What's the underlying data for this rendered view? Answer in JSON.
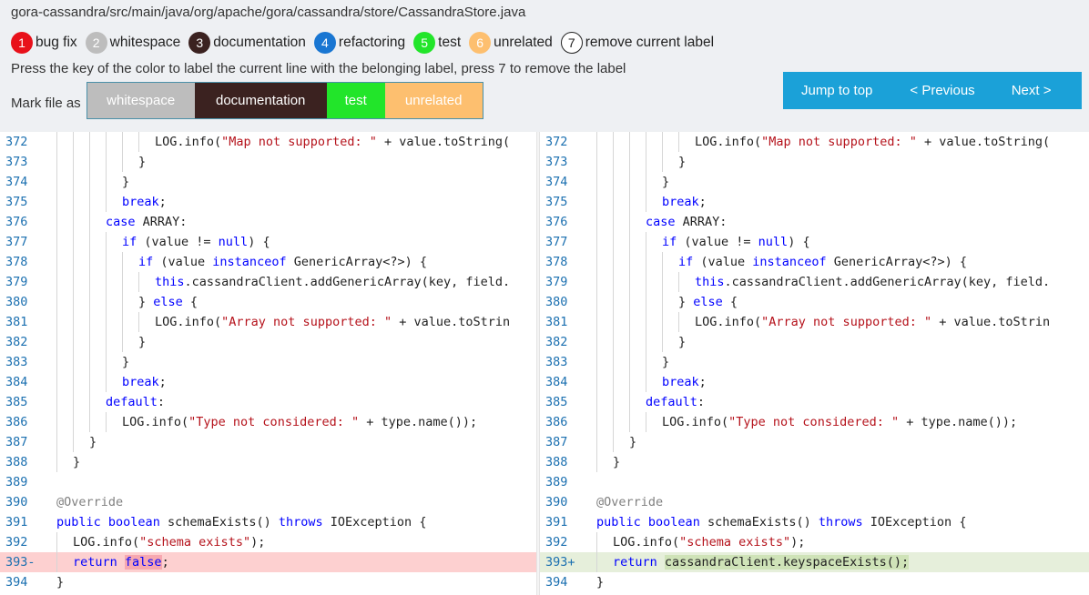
{
  "file_path": "gora-cassandra/src/main/java/org/apache/gora/cassandra/store/CassandraStore.java",
  "labels": [
    {
      "num": "1",
      "text": "bug fix",
      "color": "#e8101a"
    },
    {
      "num": "2",
      "text": "whitespace",
      "color": "#bdbdbd"
    },
    {
      "num": "3",
      "text": "documentation",
      "color": "#3b2220"
    },
    {
      "num": "4",
      "text": "refactoring",
      "color": "#1976d2"
    },
    {
      "num": "5",
      "text": "test",
      "color": "#22e52a"
    },
    {
      "num": "6",
      "text": "unrelated",
      "color": "#fdbf6f"
    },
    {
      "num": "7",
      "text": "remove current label",
      "color": "outline"
    }
  ],
  "instructions": "Press the key of the color to label the current line with the belonging label, press 7 to remove the label",
  "mark_file": {
    "label": "Mark file as",
    "buttons": [
      {
        "text": "whitespace",
        "color": "#bdbdbd"
      },
      {
        "text": "documentation",
        "color": "#3b2220"
      },
      {
        "text": "test",
        "color": "#22e52a"
      },
      {
        "text": "unrelated",
        "color": "#fdbf6f"
      }
    ]
  },
  "nav": {
    "jump_to_top": "Jump to top",
    "previous": "< Previous",
    "next": "Next >"
  },
  "colors": {
    "nav_bg": "#1ba1d8",
    "deleted_line": "#fdd0d0",
    "added_line": "#e6efdb"
  },
  "left_lines": [
    {
      "num": "372",
      "text": "LOG.info(\"Map not supported: \" + value.toString("
    },
    {
      "num": "373",
      "text": "}"
    },
    {
      "num": "374",
      "text": "}"
    },
    {
      "num": "375",
      "text": "break;"
    },
    {
      "num": "376",
      "text": "case ARRAY:"
    },
    {
      "num": "377",
      "text": "if (value != null) {"
    },
    {
      "num": "378",
      "text": "if (value instanceof GenericArray<?>) {"
    },
    {
      "num": "379",
      "text": "this.cassandraClient.addGenericArray(key, field."
    },
    {
      "num": "380",
      "text": "} else {"
    },
    {
      "num": "381",
      "text": "LOG.info(\"Array not supported: \" + value.toStrin"
    },
    {
      "num": "382",
      "text": "}"
    },
    {
      "num": "383",
      "text": "}"
    },
    {
      "num": "384",
      "text": "break;"
    },
    {
      "num": "385",
      "text": "default:"
    },
    {
      "num": "386",
      "text": "LOG.info(\"Type not considered: \" + type.name());"
    },
    {
      "num": "387",
      "text": "}"
    },
    {
      "num": "388",
      "text": "}"
    },
    {
      "num": "389",
      "text": ""
    },
    {
      "num": "390",
      "text": "@Override"
    },
    {
      "num": "391",
      "text": "public boolean schemaExists() throws IOException {"
    },
    {
      "num": "392",
      "text": "LOG.info(\"schema exists\");"
    },
    {
      "num": "393-",
      "text": "return false;"
    },
    {
      "num": "394",
      "text": "}"
    }
  ],
  "right_lines": [
    {
      "num": "372",
      "text": "LOG.info(\"Map not supported: \" + value.toString("
    },
    {
      "num": "373",
      "text": "}"
    },
    {
      "num": "374",
      "text": "}"
    },
    {
      "num": "375",
      "text": "break;"
    },
    {
      "num": "376",
      "text": "case ARRAY:"
    },
    {
      "num": "377",
      "text": "if (value != null) {"
    },
    {
      "num": "378",
      "text": "if (value instanceof GenericArray<?>) {"
    },
    {
      "num": "379",
      "text": "this.cassandraClient.addGenericArray(key, field."
    },
    {
      "num": "380",
      "text": "} else {"
    },
    {
      "num": "381",
      "text": "LOG.info(\"Array not supported: \" + value.toStrin"
    },
    {
      "num": "382",
      "text": "}"
    },
    {
      "num": "383",
      "text": "}"
    },
    {
      "num": "384",
      "text": "break;"
    },
    {
      "num": "385",
      "text": "default:"
    },
    {
      "num": "386",
      "text": "LOG.info(\"Type not considered: \" + type.name());"
    },
    {
      "num": "387",
      "text": "}"
    },
    {
      "num": "388",
      "text": "}"
    },
    {
      "num": "389",
      "text": ""
    },
    {
      "num": "390",
      "text": "@Override"
    },
    {
      "num": "391",
      "text": "public boolean schemaExists() throws IOException {"
    },
    {
      "num": "392",
      "text": "LOG.info(\"schema exists\");"
    },
    {
      "num": "393+",
      "text": "return cassandraClient.keyspaceExists();"
    },
    {
      "num": "394",
      "text": "}"
    }
  ]
}
